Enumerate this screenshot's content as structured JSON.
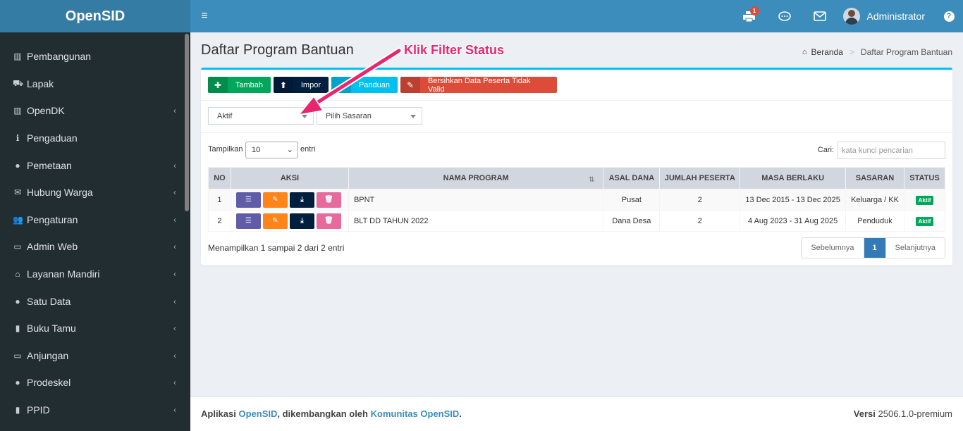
{
  "app": {
    "logo": "OpenSID"
  },
  "header": {
    "notif_count": "1",
    "user_name": "Administrator",
    "help": "?"
  },
  "sidebar": {
    "items": [
      {
        "label": "Pembangunan",
        "icon": "bank-icon",
        "glyph": "▥",
        "has_children": false
      },
      {
        "label": "Lapak",
        "icon": "cart-icon",
        "glyph": "⛟",
        "has_children": false
      },
      {
        "label": "OpenDK",
        "icon": "bank-icon",
        "glyph": "▥",
        "has_children": true
      },
      {
        "label": "Pengaduan",
        "icon": "info-icon",
        "glyph": "ℹ",
        "has_children": false
      },
      {
        "label": "Pemetaan",
        "icon": "globe-icon",
        "glyph": "●",
        "has_children": true
      },
      {
        "label": "Hubung Warga",
        "icon": "envelope-icon",
        "glyph": "✉",
        "has_children": true
      },
      {
        "label": "Pengaturan",
        "icon": "users-icon",
        "glyph": "👥",
        "has_children": true
      },
      {
        "label": "Admin Web",
        "icon": "desktop-icon",
        "glyph": "▭",
        "has_children": true
      },
      {
        "label": "Layanan Mandiri",
        "icon": "inbox-icon",
        "glyph": "⌂",
        "has_children": true
      },
      {
        "label": "Satu Data",
        "icon": "globe-icon",
        "glyph": "●",
        "has_children": true
      },
      {
        "label": "Buku Tamu",
        "icon": "book-icon",
        "glyph": "▮",
        "has_children": true
      },
      {
        "label": "Anjungan",
        "icon": "desktop-icon",
        "glyph": "▭",
        "has_children": true
      },
      {
        "label": "Prodeskel",
        "icon": "globe-icon",
        "glyph": "●",
        "has_children": true
      },
      {
        "label": "PPID",
        "icon": "book-icon",
        "glyph": "▮",
        "has_children": true
      }
    ]
  },
  "page": {
    "title": "Daftar Program Bantuan",
    "breadcrumb": {
      "home": "Beranda",
      "current": "Daftar Program Bantuan"
    }
  },
  "toolbar": {
    "tambah": "Tambah",
    "impor": "Impor",
    "panduan": "Panduan",
    "bersihkan": "Bersihkan Data Peserta Tidak Valid"
  },
  "filters": {
    "status": "Aktif",
    "sasaran": "Pilih Sasaran"
  },
  "datatable": {
    "length_prefix": "Tampilkan",
    "length_value": "10",
    "length_suffix": "entri",
    "search_label": "Cari:",
    "search_placeholder": "kata kunci pencarian",
    "columns": [
      "NO",
      "AKSI",
      "NAMA PROGRAM",
      "ASAL DANA",
      "JUMLAH PESERTA",
      "MASA BERLAKU",
      "SASARAN",
      "STATUS"
    ],
    "rows": [
      {
        "no": "1",
        "nama": "BPNT",
        "asal": "Pusat",
        "jumlah": "2",
        "masa": "13 Dec 2015 - 13 Dec 2025",
        "sasaran": "Keluarga / KK",
        "status": "Aktif"
      },
      {
        "no": "2",
        "nama": "BLT DD TAHUN 2022",
        "asal": "Dana Desa",
        "jumlah": "2",
        "masa": "4 Aug 2023 - 31 Aug 2025",
        "sasaran": "Penduduk",
        "status": "Aktif"
      }
    ],
    "info": "Menampilkan 1 sampai 2 dari 2 entri",
    "pagination": {
      "prev": "Sebelumnya",
      "page": "1",
      "next": "Selanjutnya"
    }
  },
  "annotation": {
    "text": "Klik Filter Status",
    "color": "#e8266f"
  },
  "footer": {
    "prefix": "Aplikasi",
    "app_link": "OpenSID",
    "middle": ", dikembangkan oleh",
    "community_link": "Komunitas OpenSID",
    "period": ".",
    "version_label": "Versi",
    "version_value": "2506.1.0-premium"
  }
}
